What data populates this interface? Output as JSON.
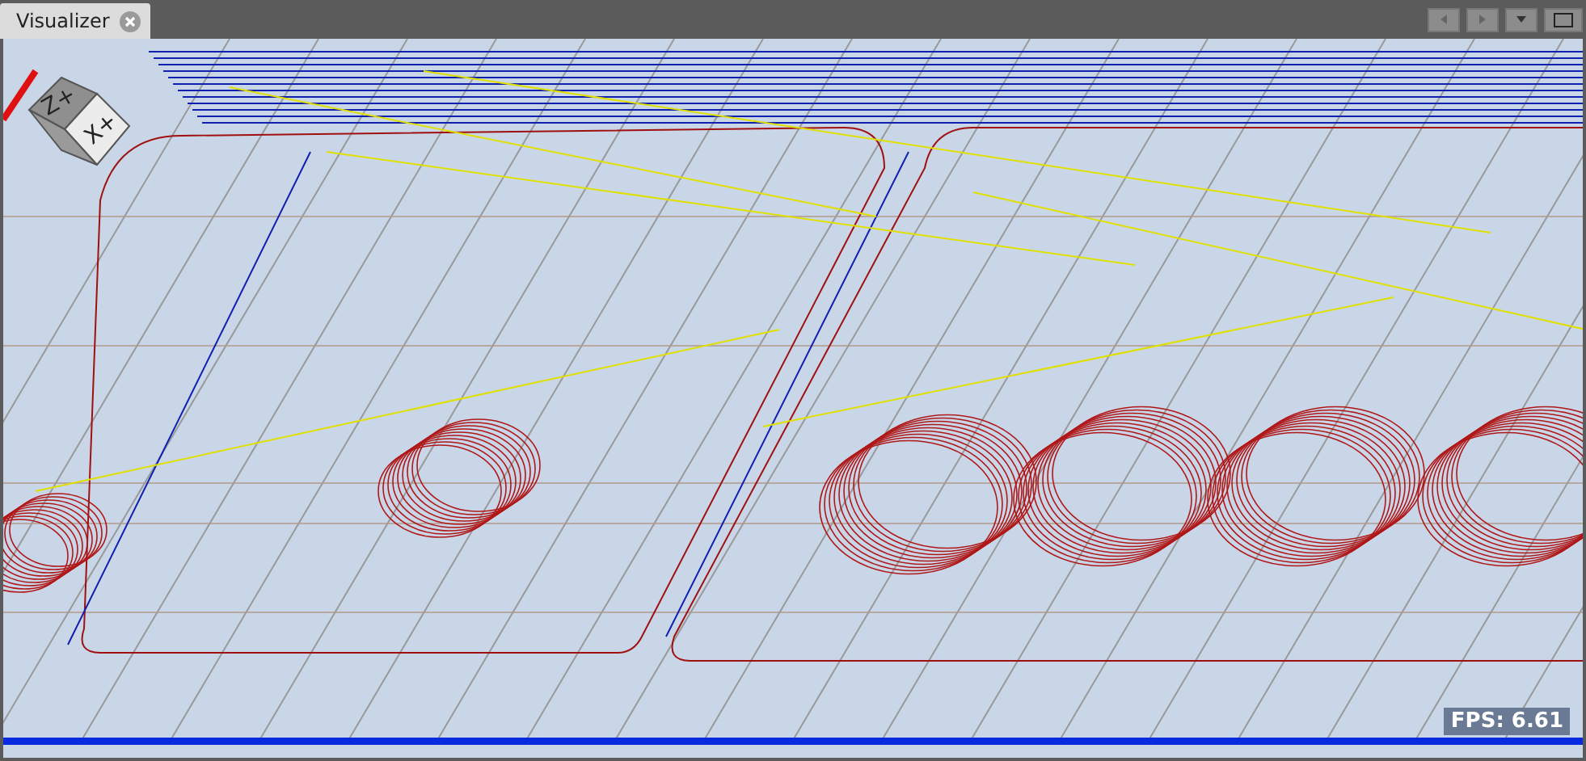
{
  "tab": {
    "label": "Visualizer",
    "selected": true
  },
  "view_cube": {
    "top_face": "Z+",
    "front_face": "X+"
  },
  "status": {
    "fps": "FPS: 6.61"
  }
}
